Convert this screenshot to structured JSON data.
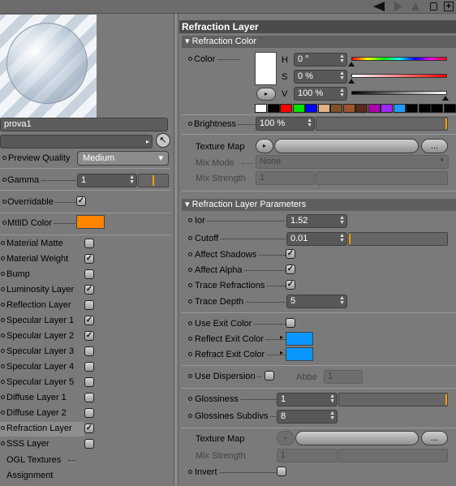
{
  "material": {
    "name": "prova1"
  },
  "left": {
    "preview_quality_label": "Preview Quality",
    "preview_quality_value": "Medium",
    "gamma_label": "Gamma",
    "gamma_value": "1",
    "overridable_label": "Overridable",
    "mtlid_label": "MtlID Color",
    "mtlid_color": "#ff8400",
    "layers": [
      {
        "label": "Material Matte",
        "checked": false
      },
      {
        "label": "Material Weight",
        "checked": true
      },
      {
        "label": "Bump",
        "checked": false
      },
      {
        "label": "Luminosity Layer",
        "checked": true
      },
      {
        "label": "Reflection Layer",
        "checked": false
      },
      {
        "label": "Specular Layer 1",
        "checked": true
      },
      {
        "label": "Specular Layer 2",
        "checked": true
      },
      {
        "label": "Specular Layer 3",
        "checked": false
      },
      {
        "label": "Specular Layer 4",
        "checked": false
      },
      {
        "label": "Specular Layer 5",
        "checked": false
      },
      {
        "label": "Diffuse Layer 1",
        "checked": false
      },
      {
        "label": "Diffuse Layer 2",
        "checked": false
      },
      {
        "label": "Refraction Layer",
        "checked": true
      },
      {
        "label": "SSS Layer",
        "checked": false
      }
    ],
    "ogl_textures": "OGL Textures",
    "assignment": "Assignment"
  },
  "right": {
    "title": "Refraction Layer",
    "color_section": "Refraction Color",
    "color_label": "Color",
    "h_label": "H",
    "h_value": "0 °",
    "s_label": "S",
    "s_value": "0 %",
    "v_label": "V",
    "v_value": "100 %",
    "swatches": [
      "#ffffff",
      "#000000",
      "#ff0000",
      "#00e000",
      "#0000ff",
      "#e0b483",
      "#80502c",
      "#a0522d",
      "#5a2a1a",
      "#b000b0",
      "#9c27ff",
      "#1e9bff",
      "#000000",
      "#000000",
      "#000000",
      "#000000",
      "#000000"
    ],
    "brightness_label": "Brightness",
    "brightness_value": "100 %",
    "texture_map_label": "Texture Map",
    "more_button": "...",
    "mix_mode_label": "Mix Mode",
    "mix_mode_value": "None",
    "mix_strength_label": "Mix Strength",
    "mix_strength_value": "1",
    "params_section": "Refraction Layer Parameters",
    "ior_label": "Ior",
    "ior_value": "1.52",
    "cutoff_label": "Cutoff",
    "cutoff_value": "0.01",
    "affect_shadows_label": "Affect Shadows",
    "affect_alpha_label": "Affect Alpha",
    "trace_refractions_label": "Trace Refractions",
    "trace_depth_label": "Trace Depth",
    "trace_depth_value": "5",
    "use_exit_color_label": "Use Exit Color",
    "reflect_exit_color_label": "Reflect Exit Color",
    "refract_exit_color_label": "Refract Exit Color",
    "exit_color": "#0a96ff",
    "use_dispersion_label": "Use Dispersion",
    "abbe_label": "Abbe",
    "abbe_value": "1",
    "glossiness_label": "Glossiness",
    "glossiness_value": "1",
    "glossines_subdivs_label": "Glossines Subdivs",
    "glossines_subdivs_value": "8",
    "texture_map2_label": "Texture Map",
    "mix_strength2_label": "Mix Strength",
    "mix_strength2_value": "1",
    "invert_label": "Invert"
  }
}
